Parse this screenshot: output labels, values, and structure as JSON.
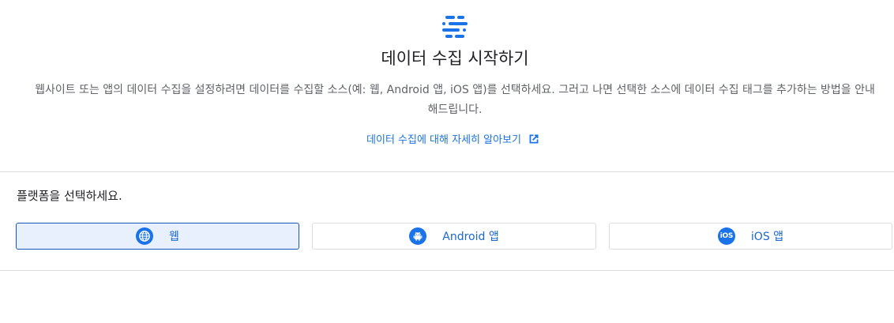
{
  "header": {
    "icon": "data-streams-icon",
    "title": "데이터 수집 시작하기",
    "description": "웹사이트 또는 앱의 데이터 수집을 설정하려면 데이터를 수집할 소스(예: 웹, Android 앱, iOS 앱)를 선택하세요. 그러고 나면 선택한 소스에 데이터 수집 태그를 추가하는 방법을 안내해드립니다.",
    "learn_more_link": "데이터 수집에 대해 자세히 알아보기",
    "learn_more_icon": "open-in-new-icon"
  },
  "platform_section": {
    "prompt": "플랫폼을 선택하세요.",
    "options": [
      {
        "label": "웹",
        "icon": "globe-icon",
        "selected": true
      },
      {
        "label": "Android 앱",
        "icon": "android-icon",
        "selected": false
      },
      {
        "label": "iOS 앱",
        "icon": "ios-icon",
        "selected": false
      }
    ]
  },
  "colors": {
    "accent": "#1a73e8",
    "link": "#1a73e8",
    "selected_bg": "#e8f0fe",
    "selected_border": "#1a56b8",
    "divider": "#dadce0"
  }
}
